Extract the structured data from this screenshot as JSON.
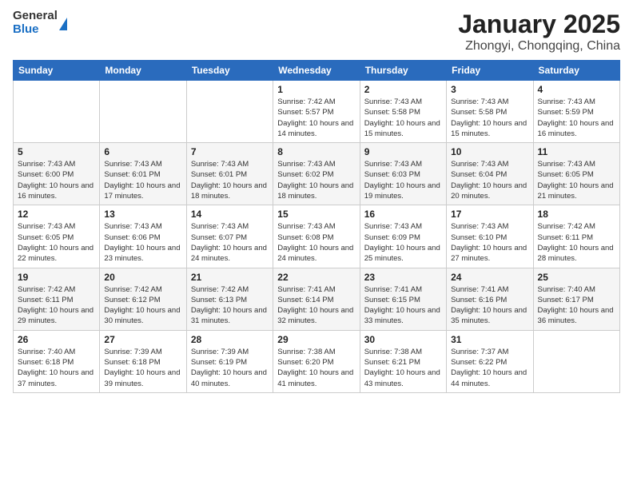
{
  "logo": {
    "general": "General",
    "blue": "Blue"
  },
  "title": {
    "month_year": "January 2025",
    "location": "Zhongyi, Chongqing, China"
  },
  "weekdays": [
    "Sunday",
    "Monday",
    "Tuesday",
    "Wednesday",
    "Thursday",
    "Friday",
    "Saturday"
  ],
  "weeks": [
    [
      {
        "day": "",
        "info": ""
      },
      {
        "day": "",
        "info": ""
      },
      {
        "day": "",
        "info": ""
      },
      {
        "day": "1",
        "info": "Sunrise: 7:42 AM\nSunset: 5:57 PM\nDaylight: 10 hours and 14 minutes."
      },
      {
        "day": "2",
        "info": "Sunrise: 7:43 AM\nSunset: 5:58 PM\nDaylight: 10 hours and 15 minutes."
      },
      {
        "day": "3",
        "info": "Sunrise: 7:43 AM\nSunset: 5:58 PM\nDaylight: 10 hours and 15 minutes."
      },
      {
        "day": "4",
        "info": "Sunrise: 7:43 AM\nSunset: 5:59 PM\nDaylight: 10 hours and 16 minutes."
      }
    ],
    [
      {
        "day": "5",
        "info": "Sunrise: 7:43 AM\nSunset: 6:00 PM\nDaylight: 10 hours and 16 minutes."
      },
      {
        "day": "6",
        "info": "Sunrise: 7:43 AM\nSunset: 6:01 PM\nDaylight: 10 hours and 17 minutes."
      },
      {
        "day": "7",
        "info": "Sunrise: 7:43 AM\nSunset: 6:01 PM\nDaylight: 10 hours and 18 minutes."
      },
      {
        "day": "8",
        "info": "Sunrise: 7:43 AM\nSunset: 6:02 PM\nDaylight: 10 hours and 18 minutes."
      },
      {
        "day": "9",
        "info": "Sunrise: 7:43 AM\nSunset: 6:03 PM\nDaylight: 10 hours and 19 minutes."
      },
      {
        "day": "10",
        "info": "Sunrise: 7:43 AM\nSunset: 6:04 PM\nDaylight: 10 hours and 20 minutes."
      },
      {
        "day": "11",
        "info": "Sunrise: 7:43 AM\nSunset: 6:05 PM\nDaylight: 10 hours and 21 minutes."
      }
    ],
    [
      {
        "day": "12",
        "info": "Sunrise: 7:43 AM\nSunset: 6:05 PM\nDaylight: 10 hours and 22 minutes."
      },
      {
        "day": "13",
        "info": "Sunrise: 7:43 AM\nSunset: 6:06 PM\nDaylight: 10 hours and 23 minutes."
      },
      {
        "day": "14",
        "info": "Sunrise: 7:43 AM\nSunset: 6:07 PM\nDaylight: 10 hours and 24 minutes."
      },
      {
        "day": "15",
        "info": "Sunrise: 7:43 AM\nSunset: 6:08 PM\nDaylight: 10 hours and 24 minutes."
      },
      {
        "day": "16",
        "info": "Sunrise: 7:43 AM\nSunset: 6:09 PM\nDaylight: 10 hours and 25 minutes."
      },
      {
        "day": "17",
        "info": "Sunrise: 7:43 AM\nSunset: 6:10 PM\nDaylight: 10 hours and 27 minutes."
      },
      {
        "day": "18",
        "info": "Sunrise: 7:42 AM\nSunset: 6:11 PM\nDaylight: 10 hours and 28 minutes."
      }
    ],
    [
      {
        "day": "19",
        "info": "Sunrise: 7:42 AM\nSunset: 6:11 PM\nDaylight: 10 hours and 29 minutes."
      },
      {
        "day": "20",
        "info": "Sunrise: 7:42 AM\nSunset: 6:12 PM\nDaylight: 10 hours and 30 minutes."
      },
      {
        "day": "21",
        "info": "Sunrise: 7:42 AM\nSunset: 6:13 PM\nDaylight: 10 hours and 31 minutes."
      },
      {
        "day": "22",
        "info": "Sunrise: 7:41 AM\nSunset: 6:14 PM\nDaylight: 10 hours and 32 minutes."
      },
      {
        "day": "23",
        "info": "Sunrise: 7:41 AM\nSunset: 6:15 PM\nDaylight: 10 hours and 33 minutes."
      },
      {
        "day": "24",
        "info": "Sunrise: 7:41 AM\nSunset: 6:16 PM\nDaylight: 10 hours and 35 minutes."
      },
      {
        "day": "25",
        "info": "Sunrise: 7:40 AM\nSunset: 6:17 PM\nDaylight: 10 hours and 36 minutes."
      }
    ],
    [
      {
        "day": "26",
        "info": "Sunrise: 7:40 AM\nSunset: 6:18 PM\nDaylight: 10 hours and 37 minutes."
      },
      {
        "day": "27",
        "info": "Sunrise: 7:39 AM\nSunset: 6:18 PM\nDaylight: 10 hours and 39 minutes."
      },
      {
        "day": "28",
        "info": "Sunrise: 7:39 AM\nSunset: 6:19 PM\nDaylight: 10 hours and 40 minutes."
      },
      {
        "day": "29",
        "info": "Sunrise: 7:38 AM\nSunset: 6:20 PM\nDaylight: 10 hours and 41 minutes."
      },
      {
        "day": "30",
        "info": "Sunrise: 7:38 AM\nSunset: 6:21 PM\nDaylight: 10 hours and 43 minutes."
      },
      {
        "day": "31",
        "info": "Sunrise: 7:37 AM\nSunset: 6:22 PM\nDaylight: 10 hours and 44 minutes."
      },
      {
        "day": "",
        "info": ""
      }
    ]
  ]
}
